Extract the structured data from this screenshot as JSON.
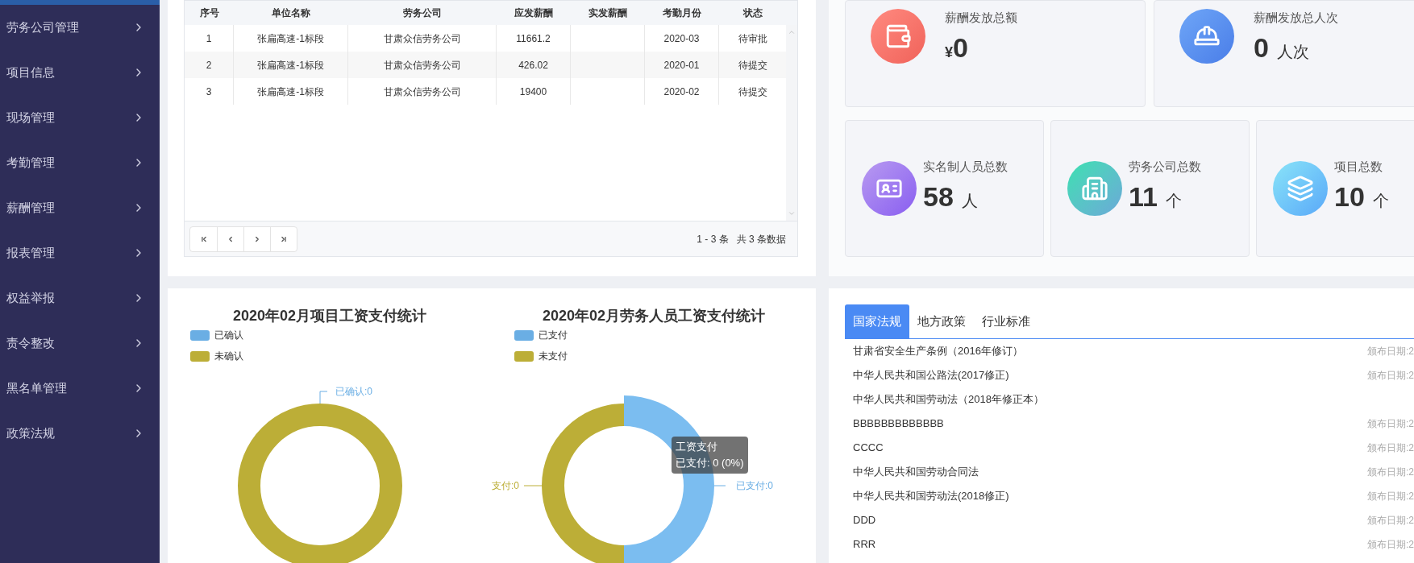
{
  "sidebar": {
    "items": [
      "劳务公司管理",
      "项目信息",
      "现场管理",
      "考勤管理",
      "薪酬管理",
      "报表管理",
      "权益举报",
      "责令整改",
      "黑名单管理",
      "政策法规"
    ]
  },
  "table": {
    "columns": [
      "序号",
      "单位名称",
      "劳务公司",
      "应发薪酬",
      "实发薪酬",
      "考勤月份",
      "状态"
    ],
    "rows": [
      [
        "1",
        "张扁高速-1标段",
        "甘肃众信劳务公司",
        "11661.2",
        "",
        "2020-03",
        "待审批"
      ],
      [
        "2",
        "张扁高速-1标段",
        "甘肃众信劳务公司",
        "426.02",
        "",
        "2020-01",
        "待提交"
      ],
      [
        "3",
        "张扁高速-1标段",
        "甘肃众信劳务公司",
        "19400",
        "",
        "2020-02",
        "待提交"
      ]
    ],
    "range": "1 - 3 条",
    "total": "共 3 条数据"
  },
  "stats_top": [
    {
      "label": "薪酬发放总额",
      "prefix": "¥",
      "value": "0"
    },
    {
      "label": "薪酬发放总人次",
      "value": "0",
      "unit": "人次"
    }
  ],
  "stats_bottom": [
    {
      "label": "实名制人员总数",
      "value": "58",
      "unit": "人"
    },
    {
      "label": "劳务公司总数",
      "value": "11",
      "unit": "个"
    },
    {
      "label": "项目总数",
      "value": "10",
      "unit": "个"
    }
  ],
  "charts": [
    {
      "title": "2020年02月项目工资支付统计",
      "legend": [
        {
          "label": "已确认",
          "color": "#6aaee4"
        },
        {
          "label": "未确认",
          "color": "#bcae37"
        }
      ],
      "kind": "ring",
      "labels": [
        "已确认:0"
      ]
    },
    {
      "title": "2020年02月劳务人员工资支付统计",
      "legend": [
        {
          "label": "已支付",
          "color": "#6aaee4"
        },
        {
          "label": "未支付",
          "color": "#bcae37"
        }
      ],
      "kind": "split",
      "labels": [
        "支付:0",
        "已支付:0"
      ],
      "tooltip": {
        "title": "工资支付",
        "text": "已支付: 0 (0%)"
      }
    }
  ],
  "policy": {
    "tabs": [
      {
        "label": "国家法规",
        "selected": true
      },
      {
        "label": "地方政策",
        "selected": false
      },
      {
        "label": "行业标准",
        "selected": false
      }
    ],
    "items": [
      {
        "title": "甘肃省安全生产条例（2016年修订）",
        "date": "颁布日期:2"
      },
      {
        "title": "中华人民共和国公路法(2017修正)",
        "date": "颁布日期:2"
      },
      {
        "title": "中华人民共和国劳动法（2018年修正本）"
      },
      {
        "title": "BBBBBBBBBBBBB",
        "date": "颁布日期:2"
      },
      {
        "title": "CCCC",
        "date": "颁布日期:2"
      },
      {
        "title": "中华人民共和国劳动合同法",
        "date": "颁布日期:2"
      },
      {
        "title": "中华人民共和国劳动法(2018修正)",
        "date": "颁布日期:2"
      },
      {
        "title": "DDD",
        "date": "颁布日期:2"
      },
      {
        "title": "RRR",
        "date": "颁布日期:2"
      }
    ]
  }
}
